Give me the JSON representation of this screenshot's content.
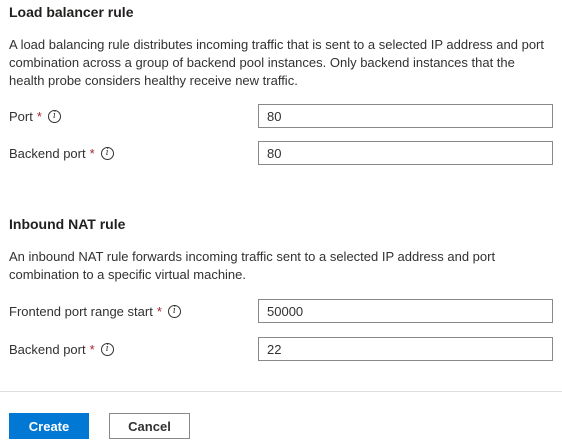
{
  "load_balancer": {
    "title": "Load balancer rule",
    "description": "A load balancing rule distributes incoming traffic that is sent to a selected IP address and port combination across a group of backend pool instances. Only backend instances that the health probe considers healthy receive new traffic.",
    "fields": [
      {
        "label": "Port",
        "required_mark": "*",
        "value": "80"
      },
      {
        "label": "Backend port",
        "required_mark": "*",
        "value": "80"
      }
    ]
  },
  "inbound_nat": {
    "title": "Inbound NAT rule",
    "description": "An inbound NAT rule forwards incoming traffic sent to a selected IP address and port combination to a specific virtual machine.",
    "fields": [
      {
        "label": "Frontend port range start",
        "required_mark": "*",
        "value": "50000"
      },
      {
        "label": "Backend port",
        "required_mark": "*",
        "value": "22"
      }
    ]
  },
  "info_glyph": "i",
  "footer": {
    "create_label": "Create",
    "cancel_label": "Cancel"
  },
  "colors": {
    "primary": "#0078d4",
    "required": "#a4262c"
  }
}
